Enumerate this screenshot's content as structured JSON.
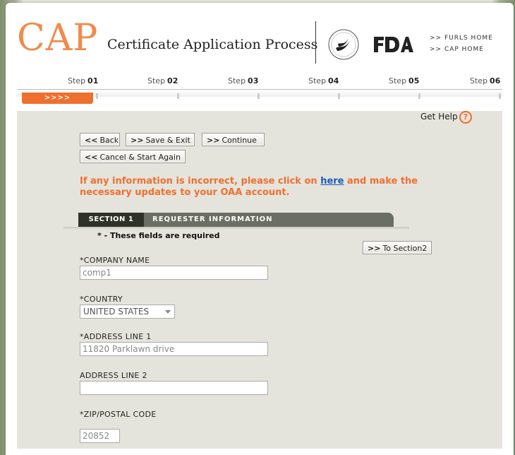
{
  "header": {
    "logo": "CAP",
    "subtitle": "Certificate Application Process",
    "links": [
      ">> FURLS HOME",
      ">> CAP HOME"
    ]
  },
  "steps": {
    "label": "Step",
    "numbers": [
      "01",
      "02",
      "03",
      "04",
      "05",
      "06"
    ],
    "current_marker": ">>>>"
  },
  "help": {
    "label": "Get Help",
    "icon": "?"
  },
  "buttons": {
    "back": "Back",
    "save_exit": "Save & Exit",
    "continue": "Continue",
    "cancel_start": "Cancel & Start Again",
    "to_section2": "To Section2",
    "chevron": ">>",
    "back_chevron": "<<"
  },
  "notice": {
    "before": "If any information is incorrect, please click on ",
    "link": "here",
    "after": " and make the necessary updates to your OAA account."
  },
  "section": {
    "tab": "SECTION 1",
    "title": "REQUESTER INFORMATION",
    "required_note": "* - These fields are required"
  },
  "form": {
    "company_label": "*COMPANY NAME",
    "company_value": "comp1",
    "country_label": "*COUNTRY",
    "country_value": "UNITED STATES",
    "address1_label": "*ADDRESS LINE 1",
    "address1_value": "11820 Parklawn drive",
    "address2_label": "ADDRESS LINE 2",
    "address2_value": "",
    "zip_label": "*ZIP/POSTAL CODE",
    "zip_value": "20852"
  },
  "colors": {
    "accent": "#ef6f2e",
    "logo": "#f08a4b",
    "link": "#1a5bb8",
    "panel": "#e5e4dc",
    "bar": "#6a6e64",
    "tab": "#2f3327"
  }
}
